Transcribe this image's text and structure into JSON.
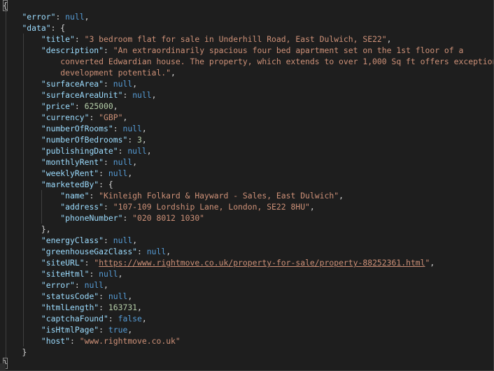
{
  "json": {
    "error_key": "\"error\"",
    "data_key": "\"data\"",
    "title_key": "\"title\"",
    "title_val": "\"3 bedroom flat for sale in Underhill Road, East Dulwich, SE22\"",
    "description_key": "\"description\"",
    "description_val_1": "\"An extraordinarily spacious four bed apartment set on the 1st floor of a",
    "description_val_2": "converted Edwardian house. The property, which extends to over 1,000 Sq ft offers exceptional",
    "description_val_3": "development potential.\"",
    "surfaceArea_key": "\"surfaceArea\"",
    "surfaceAreaUnit_key": "\"surfaceAreaUnit\"",
    "price_key": "\"price\"",
    "price_val": "625000",
    "currency_key": "\"currency\"",
    "currency_val": "\"GBP\"",
    "numberOfRooms_key": "\"numberOfRooms\"",
    "numberOfBedrooms_key": "\"numberOfBedrooms\"",
    "numberOfBedrooms_val": "3",
    "publishingDate_key": "\"publishingDate\"",
    "monthlyRent_key": "\"monthlyRent\"",
    "weeklyRent_key": "\"weeklyRent\"",
    "marketedBy_key": "\"marketedBy\"",
    "name_key": "\"name\"",
    "name_val": "\"Kinleigh Folkard & Hayward - Sales, East Dulwich\"",
    "address_key": "\"address\"",
    "address_val": "\"107-109 Lordship Lane, London, SE22 8HU\"",
    "phoneNumber_key": "\"phoneNumber\"",
    "phoneNumber_val": "\"020 8012 1030\"",
    "energyClass_key": "\"energyClass\"",
    "greenhouseGazClass_key": "\"greenhouseGazClass\"",
    "siteURL_key": "\"siteURL\"",
    "siteURL_url": "https://www.rightmove.co.uk/property-for-sale/property-88252361.html",
    "siteHtml_key": "\"siteHtml\"",
    "error2_key": "\"error\"",
    "statusCode_key": "\"statusCode\"",
    "htmlLength_key": "\"htmlLength\"",
    "htmlLength_val": "163731",
    "captchaFound_key": "\"captchaFound\"",
    "captchaFound_val": "false",
    "isHtmlPage_key": "\"isHtmlPage\"",
    "isHtmlPage_val": "true",
    "host_key": "\"host\"",
    "host_val": "\"www.rightmove.co.uk\"",
    "null": "null",
    "quote": "\""
  },
  "colors": {
    "background": "#1e1e1e",
    "key": "#9cdcfe",
    "string": "#ce9178",
    "number": "#b5cea8",
    "keyword": "#569cd6"
  }
}
